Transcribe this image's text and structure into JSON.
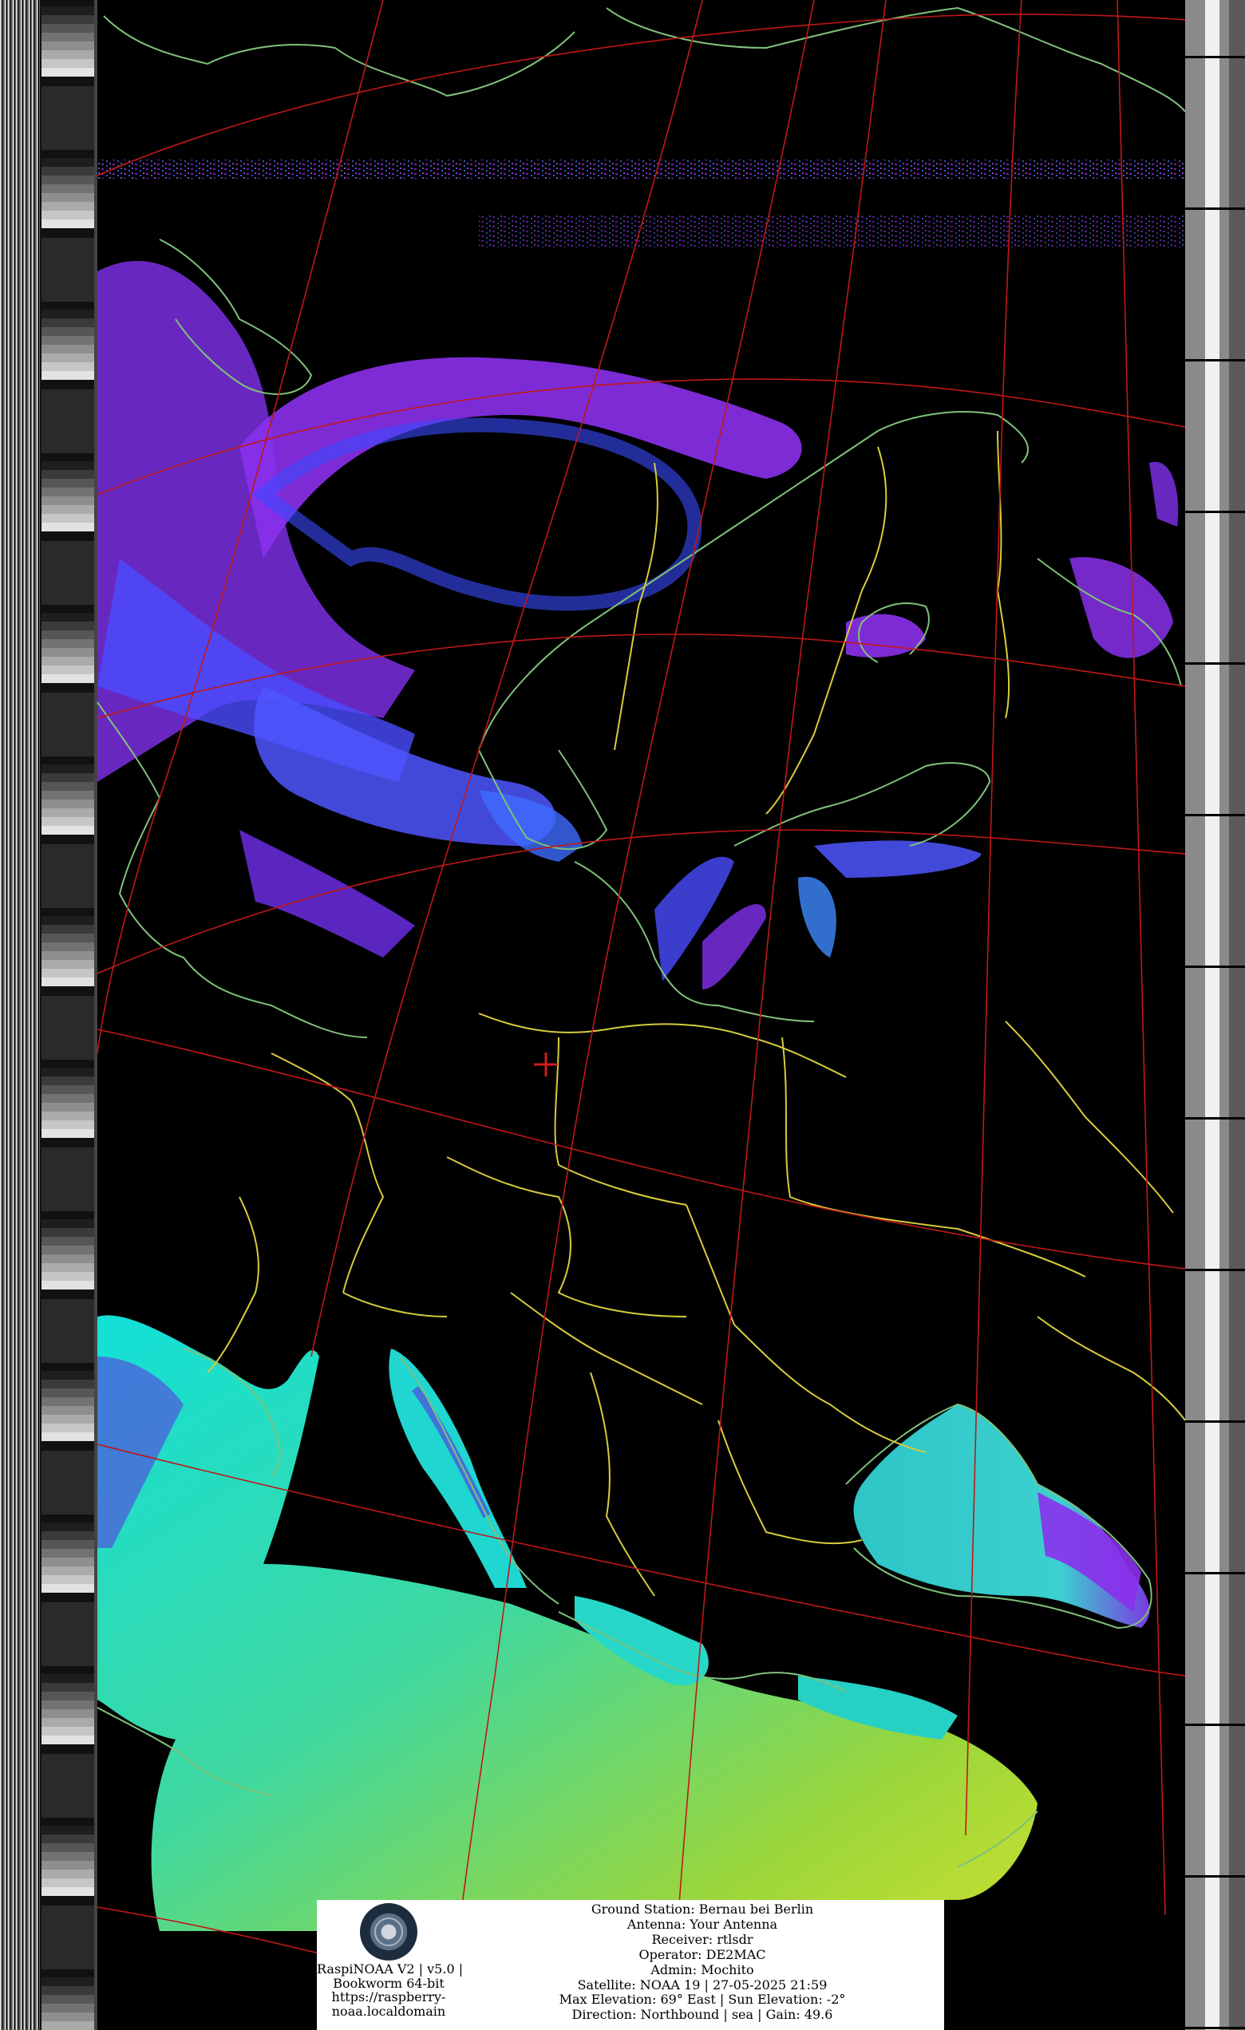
{
  "image": {
    "type": "NOAA APT satellite image",
    "projection_grid_color": "#c01818",
    "coastline_color": "#7fc27a",
    "border_color": "#d6cc3c",
    "cloud_colors": [
      "#8a2be2",
      "#4b4bff",
      "#00c8c8",
      "#9ad23a"
    ],
    "crosshair_color": "#d01c1c"
  },
  "caption": {
    "left": {
      "logo": "raspinoaa-globe-logo",
      "line1": "RaspiNOAA V2 | v5.0 |",
      "line2": "Bookworm 64-bit",
      "line3": "https://raspberry-",
      "line4": "noaa.localdomain"
    },
    "right": {
      "line1": "Ground Station: Bernau bei Berlin",
      "line2": "Antenna: Your Antenna",
      "line3": "Receiver: rtlsdr",
      "line4": "Operator: DE2MAC",
      "line5": "Admin: Mochito",
      "line6": "Satellite: NOAA 19 | 27-05-2025 21:59",
      "line7": "Max Elevation: 69° East | Sun Elevation: -2°",
      "line8": "Direction: Northbound | sea | Gain: 49.6"
    }
  }
}
